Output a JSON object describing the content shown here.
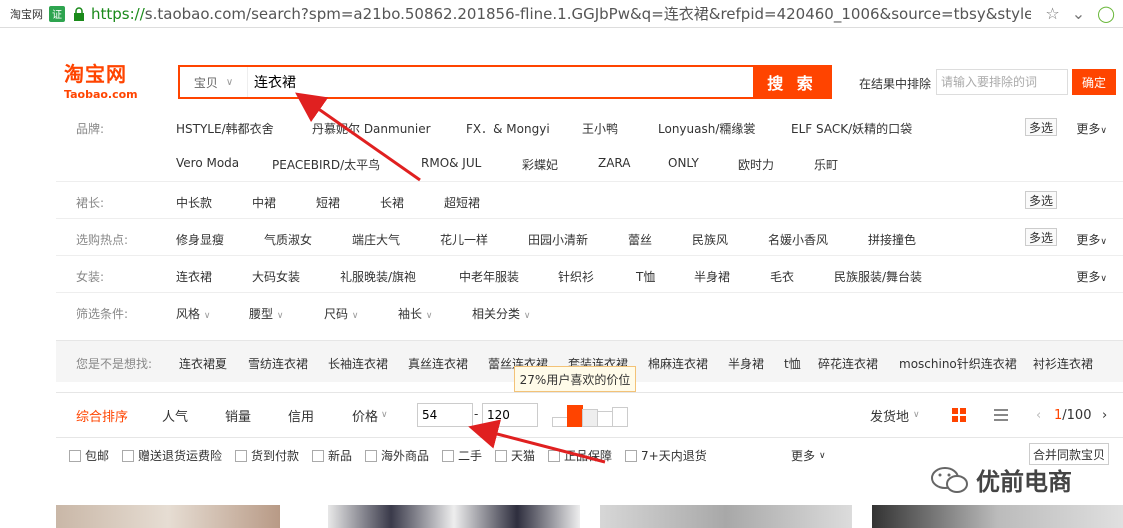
{
  "browser": {
    "site_tag": "淘宝网",
    "ev_badge": "证",
    "url_scheme": "https://",
    "url_rest": "s.taobao.com/search?spm=a21bo.50862.201856-fline.1.GGJbPw&q=连衣裙&refpid=420460_1006&source=tbsy&style"
  },
  "logo": {
    "cn": "淘宝网",
    "en": "Taobao.com"
  },
  "search": {
    "type_label": "宝贝",
    "query": "连衣裙",
    "button": "搜 索",
    "exclude_label": "在结果中排除",
    "exclude_placeholder": "请输入要排除的词",
    "exclude_button": "确定"
  },
  "filters": {
    "brand": {
      "label": "品牌:",
      "row1": [
        "HSTYLE/韩都衣舍",
        "丹慕妮尔 Danmunier",
        "FX．& Mongyi",
        "王小鸭",
        "Lonyuash/糥缘裳",
        "ELF SACK/妖精的口袋"
      ],
      "row2": [
        "Vero Moda",
        "PEACEBIRD/太平鸟",
        "RMO& JUL",
        "彩蝶妃",
        "ZARA",
        "ONLY",
        "欧时力",
        "乐町"
      ],
      "multi": "多选",
      "more": "更多"
    },
    "length": {
      "label": "裙长:",
      "items": [
        "中长款",
        "中裙",
        "短裙",
        "长裙",
        "超短裙"
      ],
      "multi": "多选"
    },
    "hot": {
      "label": "选购热点:",
      "items": [
        "修身显瘦",
        "气质淑女",
        "端庄大气",
        "花儿一样",
        "田园小清新",
        "蕾丝",
        "民族风",
        "名媛小香风",
        "拼接撞色"
      ],
      "multi": "多选",
      "more": "更多"
    },
    "women": {
      "label": "女装:",
      "items": [
        "连衣裙",
        "大码女装",
        "礼服晚装/旗袍",
        "中老年服装",
        "针织衫",
        "T恤",
        "半身裙",
        "毛衣",
        "民族服装/舞台装"
      ],
      "more": "更多"
    },
    "conditions": {
      "label": "筛选条件:",
      "items": [
        "风格",
        "腰型",
        "尺码",
        "袖长",
        "相关分类"
      ]
    }
  },
  "suggest": {
    "label": "您是不是想找:",
    "items": [
      "连衣裙夏",
      "雪纺连衣裙",
      "长袖连衣裙",
      "真丝连衣裙",
      "蕾丝连衣裙",
      "套装连衣裙",
      "棉麻连衣裙",
      "半身裙",
      "t恤",
      "碎花连衣裙",
      "moschino针织连衣裙",
      "衬衫连衣裙"
    ]
  },
  "tooltip": "27%用户喜欢的价位",
  "sortbar": {
    "tabs": [
      "综合排序",
      "人气",
      "销量",
      "信用",
      "价格"
    ],
    "price_min": "54",
    "price_max": "120",
    "ship_from": "发货地",
    "page": "1",
    "total_pages": "/100"
  },
  "checks": {
    "items": [
      "包邮",
      "赠送退货运费险",
      "货到付款",
      "新品",
      "海外商品",
      "二手",
      "天猫",
      "正品保障",
      "7+天内退货"
    ],
    "more": "更多",
    "merge": "合并同款宝贝"
  },
  "watermark": "优前电商",
  "colors": {
    "accent": "#ff4400",
    "arrow": "#e02020"
  }
}
